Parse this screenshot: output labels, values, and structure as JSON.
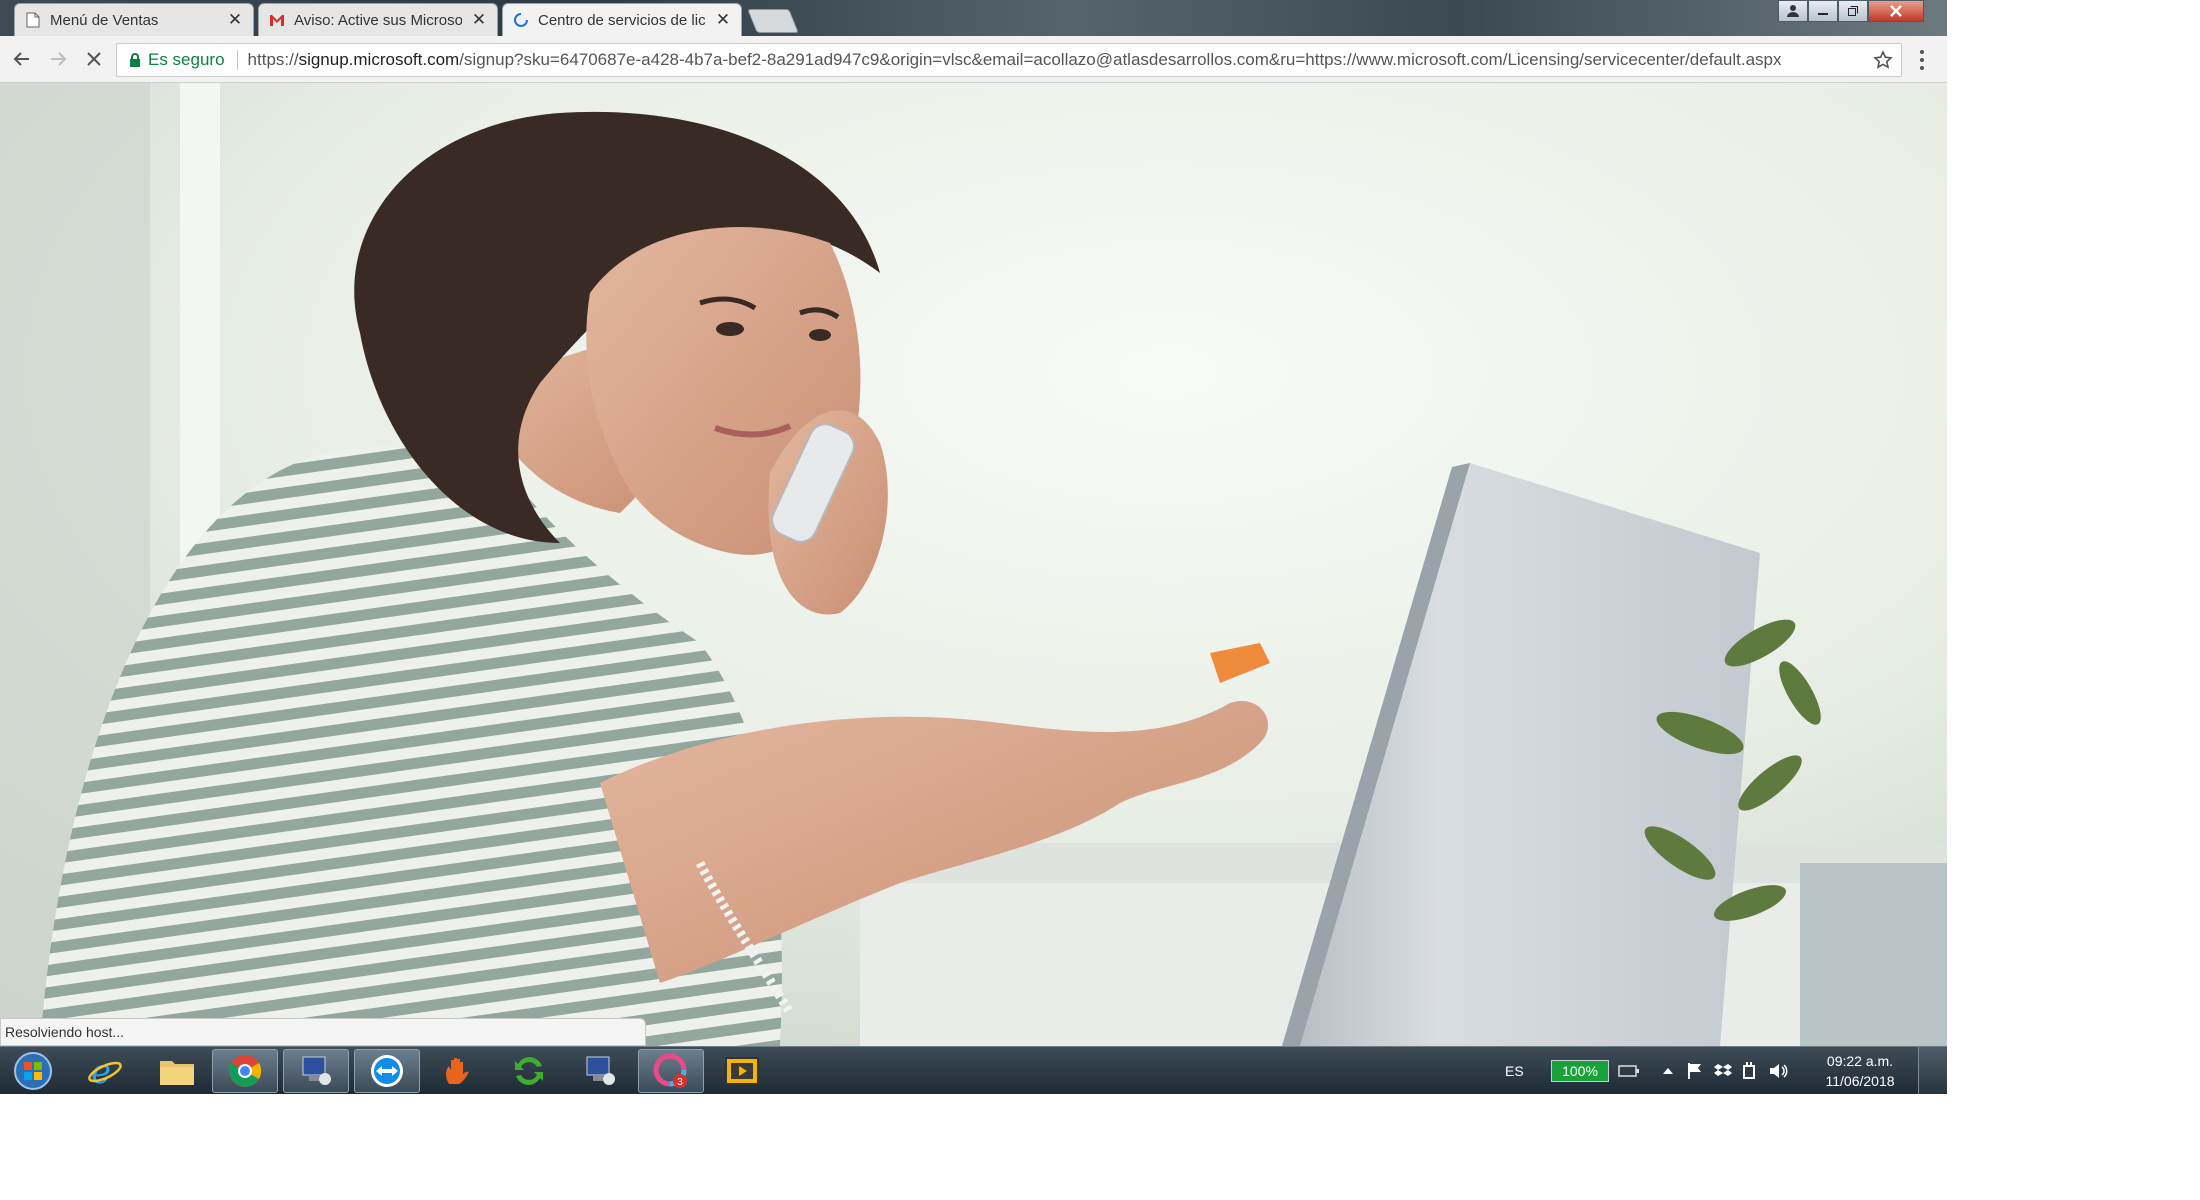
{
  "browser": {
    "tabs": [
      {
        "label": "Menú de Ventas",
        "icon": "page-icon"
      },
      {
        "label": "Aviso: Active sus Microso",
        "icon": "gmail-icon"
      },
      {
        "label": "Centro de servicios de lic",
        "icon": "loading-icon"
      }
    ],
    "close_glyph": "✕",
    "address": {
      "secure_label": "Es seguro",
      "url_scheme": "https://",
      "url_host": "signup.microsoft.com",
      "url_rest": "/signup?sku=6470687e-a428-4b7a-bef2-8a291ad947c9&origin=vlsc&email=acollazo@atlasdesarrollos.com&ru=https://www.microsoft.com/Licensing/servicecenter/default.aspx"
    },
    "status_text": "Resolviendo host..."
  },
  "taskbar": {
    "pinned": [
      "start-orb-icon",
      "internet-explorer-icon",
      "file-explorer-icon",
      "chrome-icon",
      "remote-desktop-icon",
      "teamviewer-icon",
      "hand-app-icon",
      "sync-app-icon",
      "remote-desktop-2-icon",
      "badge-app-icon",
      "media-player-icon"
    ],
    "badge_count": "3",
    "language": "ES",
    "battery": "100%",
    "time": "09:22 a.m.",
    "date": "11/06/2018"
  }
}
